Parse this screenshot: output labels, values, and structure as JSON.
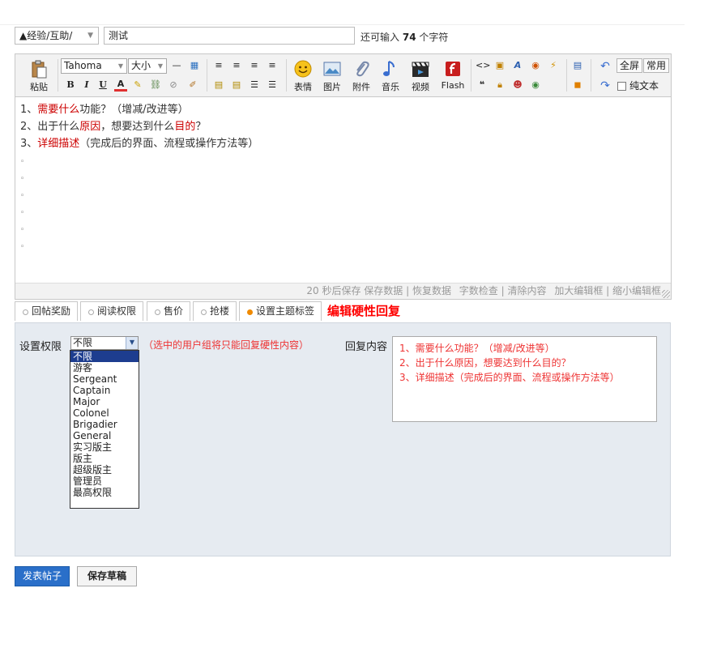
{
  "top": {
    "category": "▲经验/互助/",
    "title_value": "测试",
    "remain_prefix": "还可输入",
    "remain_count": "74",
    "remain_suffix": "个字符"
  },
  "toolbar": {
    "paste": "粘贴",
    "font_family": "Tahoma",
    "font_size": "大小",
    "emoji": "表情",
    "image": "图片",
    "attach": "附件",
    "music": "音乐",
    "video": "视频",
    "flash": "Flash",
    "fullscreen": "全屏",
    "common": "常用",
    "plaintext": "纯文本"
  },
  "content": {
    "line1_num": "1、",
    "line1_red": "需要什么",
    "line1_rest": "功能？（增减/改进等）",
    "line2_num": "2、出于什么",
    "line2_red1": "原因",
    "line2_mid": "，想要达到什么",
    "line2_red2": "目的",
    "line2_end": "？",
    "line3_num": "3、",
    "line3_red": "详细描述",
    "line3_rest": "（完成后的界面、流程或操作方法等）"
  },
  "statusbar": {
    "autosave": "20 秒后保存 保存数据 | 恢复数据",
    "check": "字数检查 | 清除内容",
    "resize": "加大编辑框 | 缩小编辑框"
  },
  "tabs": [
    {
      "label": "回帖奖励"
    },
    {
      "label": "阅读权限"
    },
    {
      "label": "售价"
    },
    {
      "label": "抢楼"
    },
    {
      "label": "设置主题标签"
    }
  ],
  "active_tab": "编辑硬性回复",
  "panel": {
    "perm_label": "设置权限",
    "perm_selected": "不限",
    "perm_hint": "（选中的用户组将只能回复硬性内容）",
    "reply_label": "回复内容",
    "reply_text": "1、需要什么功能？（增减/改进等）\n2、出于什么原因，想要达到什么目的？\n3、详细描述（完成后的界面、流程或操作方法等）",
    "options": [
      "不限",
      "游客",
      "Sergeant",
      "Captain",
      "Major",
      "Colonel",
      "Brigadier",
      "General",
      "实习版主",
      "版主",
      "超级版主",
      "管理员",
      "最高权限"
    ]
  },
  "buttons": {
    "post": "发表帖子",
    "draft": "保存草稿"
  },
  "colors": {
    "accent_blue": "#2a6fc9",
    "hint_red": "#e33333",
    "panel_bg": "#e6ebf1",
    "selected_option": "#1d3d8f"
  }
}
